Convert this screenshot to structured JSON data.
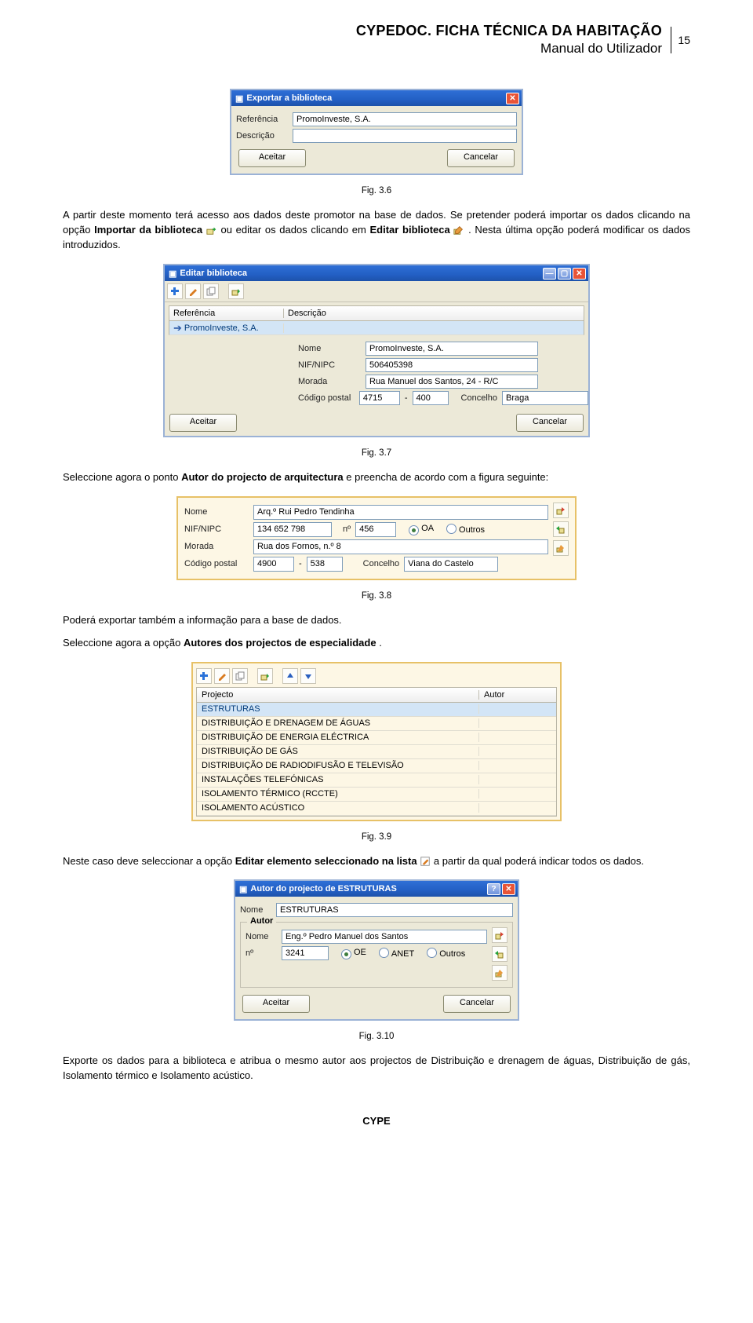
{
  "header": {
    "title": "CYPEDOC. FICHA TÉCNICA DA HABITAÇÃO",
    "subtitle": "Manual do Utilizador",
    "page_num": "15"
  },
  "fig36": {
    "caption": "Fig. 3.6",
    "win_title": "Exportar a biblioteca",
    "ref_label": "Referência",
    "ref_value": "PromoInveste, S.A.",
    "desc_label": "Descrição",
    "desc_value": "",
    "accept": "Aceitar",
    "cancel": "Cancelar"
  },
  "para1_a": "A partir deste momento terá acesso aos dados deste promotor na base de dados. Se pretender poderá importar os dados clicando na opção ",
  "para1_b": "Importar da biblioteca",
  "para1_c": " ou editar os dados clicando em ",
  "para1_d": "Editar biblioteca",
  "para1_e": ". Nesta última opção poderá modificar os dados introduzidos.",
  "fig37": {
    "caption": "Fig. 3.7",
    "win_title": "Editar biblioteca",
    "col_ref": "Referência",
    "col_desc": "Descrição",
    "row_ref": "PromoInveste, S.A.",
    "nome_label": "Nome",
    "nome_value": "PromoInveste, S.A.",
    "nif_label": "NIF/NIPC",
    "nif_value": "506405398",
    "morada_label": "Morada",
    "morada_value": "Rua Manuel dos Santos, 24 - R/C",
    "cp_label": "Código postal",
    "cp1": "4715",
    "cp_sep": "-",
    "cp2": "400",
    "concelho_label": "Concelho",
    "concelho_value": "Braga",
    "accept": "Aceitar",
    "cancel": "Cancelar"
  },
  "para2_a": "Seleccione agora o ponto ",
  "para2_b": "Autor do projecto de arquitectura",
  "para2_c": " e preencha de acordo com a figura seguinte:",
  "fig38": {
    "caption": "Fig. 3.8",
    "nome_label": "Nome",
    "nome_value": "Arq.º Rui Pedro Tendinha",
    "nif_label": "NIF/NIPC",
    "nif_value": "134 652 798",
    "num_label": "nº",
    "num_value": "456",
    "oa": "OA",
    "outros": "Outros",
    "morada_label": "Morada",
    "morada_value": "Rua dos Fornos, n.º 8",
    "cp_label": "Código postal",
    "cp1": "4900",
    "cp_sep": "-",
    "cp2": "538",
    "concelho_label": "Concelho",
    "concelho_value": "Viana do Castelo"
  },
  "para3": "Poderá exportar também a informação para a base de dados.",
  "para4_a": "Seleccione agora a opção ",
  "para4_b": "Autores dos projectos de especialidade",
  "para4_c": ".",
  "fig39": {
    "caption": "Fig. 3.9",
    "col_proj": "Projecto",
    "col_autor": "Autor",
    "rows": [
      "ESTRUTURAS",
      "DISTRIBUIÇÃO E DRENAGEM DE ÁGUAS",
      "DISTRIBUIÇÃO DE ENERGIA ELÉCTRICA",
      "DISTRIBUIÇÃO DE GÁS",
      "DISTRIBUIÇÃO DE RADIODIFUSÃO E TELEVISÃO",
      "INSTALAÇÕES TELEFÓNICAS",
      "ISOLAMENTO TÉRMICO (RCCTE)",
      "ISOLAMENTO ACÚSTICO"
    ]
  },
  "para5_a": "Neste caso deve seleccionar a opção ",
  "para5_b": "Editar elemento seleccionado na lista",
  "para5_c": " a partir da qual poderá indicar todos os dados.",
  "fig310": {
    "caption": "Fig. 3.10",
    "win_title": "Autor do projecto de ESTRUTURAS",
    "nome_label": "Nome",
    "nome_value": "ESTRUTURAS",
    "group_label": "Autor",
    "autor_nome_label": "Nome",
    "autor_nome_value": "Eng.º Pedro Manuel dos Santos",
    "num_label": "nº",
    "num_value": "3241",
    "oe": "OE",
    "anet": "ANET",
    "outros": "Outros",
    "accept": "Aceitar",
    "cancel": "Cancelar"
  },
  "para6": "Exporte os dados para a biblioteca e atribua o mesmo autor aos projectos de Distribuição e drenagem de águas, Distribuição de gás, Isolamento térmico e Isolamento acústico.",
  "footer": "CYPE"
}
